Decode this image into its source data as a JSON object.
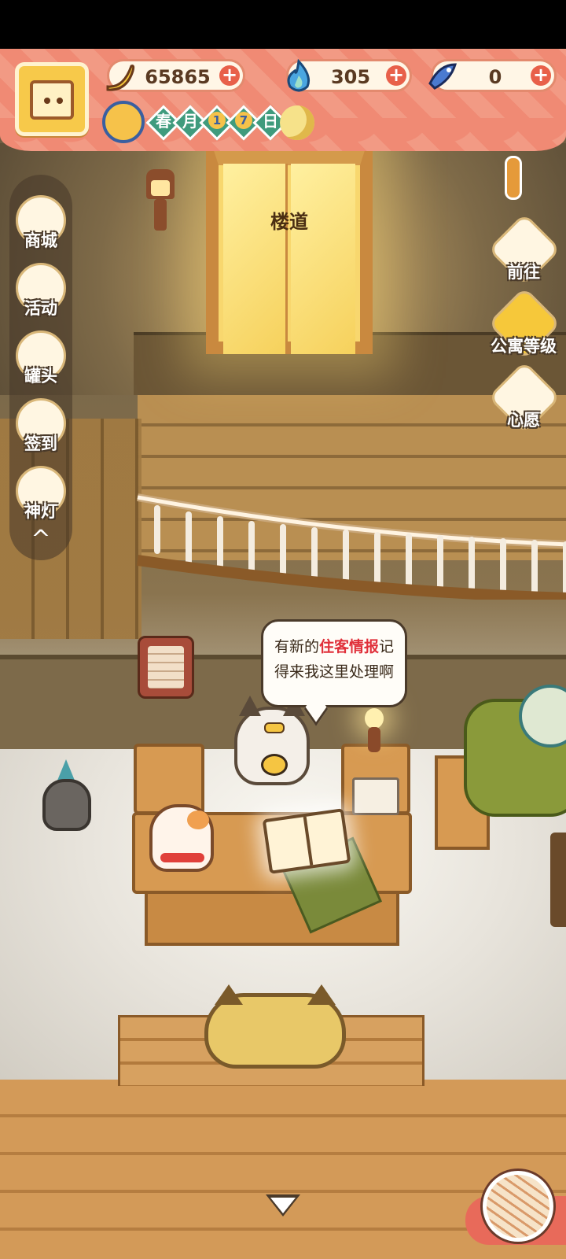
{
  "hud": {
    "resources": [
      {
        "name": "banana",
        "icon": "banana-icon",
        "value": "65865"
      },
      {
        "name": "blue-flame",
        "icon": "blue-flame-icon",
        "value": "305"
      },
      {
        "name": "fish",
        "icon": "fish-icon",
        "value": "0"
      }
    ],
    "date": {
      "season": "春",
      "month": "月",
      "day_digits": [
        "1",
        "7"
      ],
      "day_suffix": "日"
    }
  },
  "scene": {
    "elevator_sign": "楼道"
  },
  "sidebar": {
    "items": [
      {
        "label": "商城",
        "icon": "shop-icon"
      },
      {
        "label": "活动",
        "icon": "gift-icon"
      },
      {
        "label": "罐头",
        "icon": "can-icon"
      },
      {
        "label": "签到",
        "icon": "checkin-icon"
      },
      {
        "label": "神灯",
        "icon": "magic-lamp-icon"
      }
    ],
    "collapse": "^"
  },
  "right_menu": {
    "items": [
      {
        "label": "前往",
        "icon": "map-pin-icon"
      },
      {
        "label": "公寓等级",
        "icon": "apartment-level-icon"
      },
      {
        "label": "心愿",
        "icon": "wish-book-icon"
      }
    ]
  },
  "bubble": {
    "line1_pre": "有新的",
    "line1_highlight": "住客情报",
    "line1_post": "记",
    "line2": "得来我这里处理啊"
  },
  "colors": {
    "hud_band": "#f08a74",
    "highlight_text": "#e0303a",
    "plus_button": "#e8604a",
    "date_tag": "#3f9b7d"
  }
}
